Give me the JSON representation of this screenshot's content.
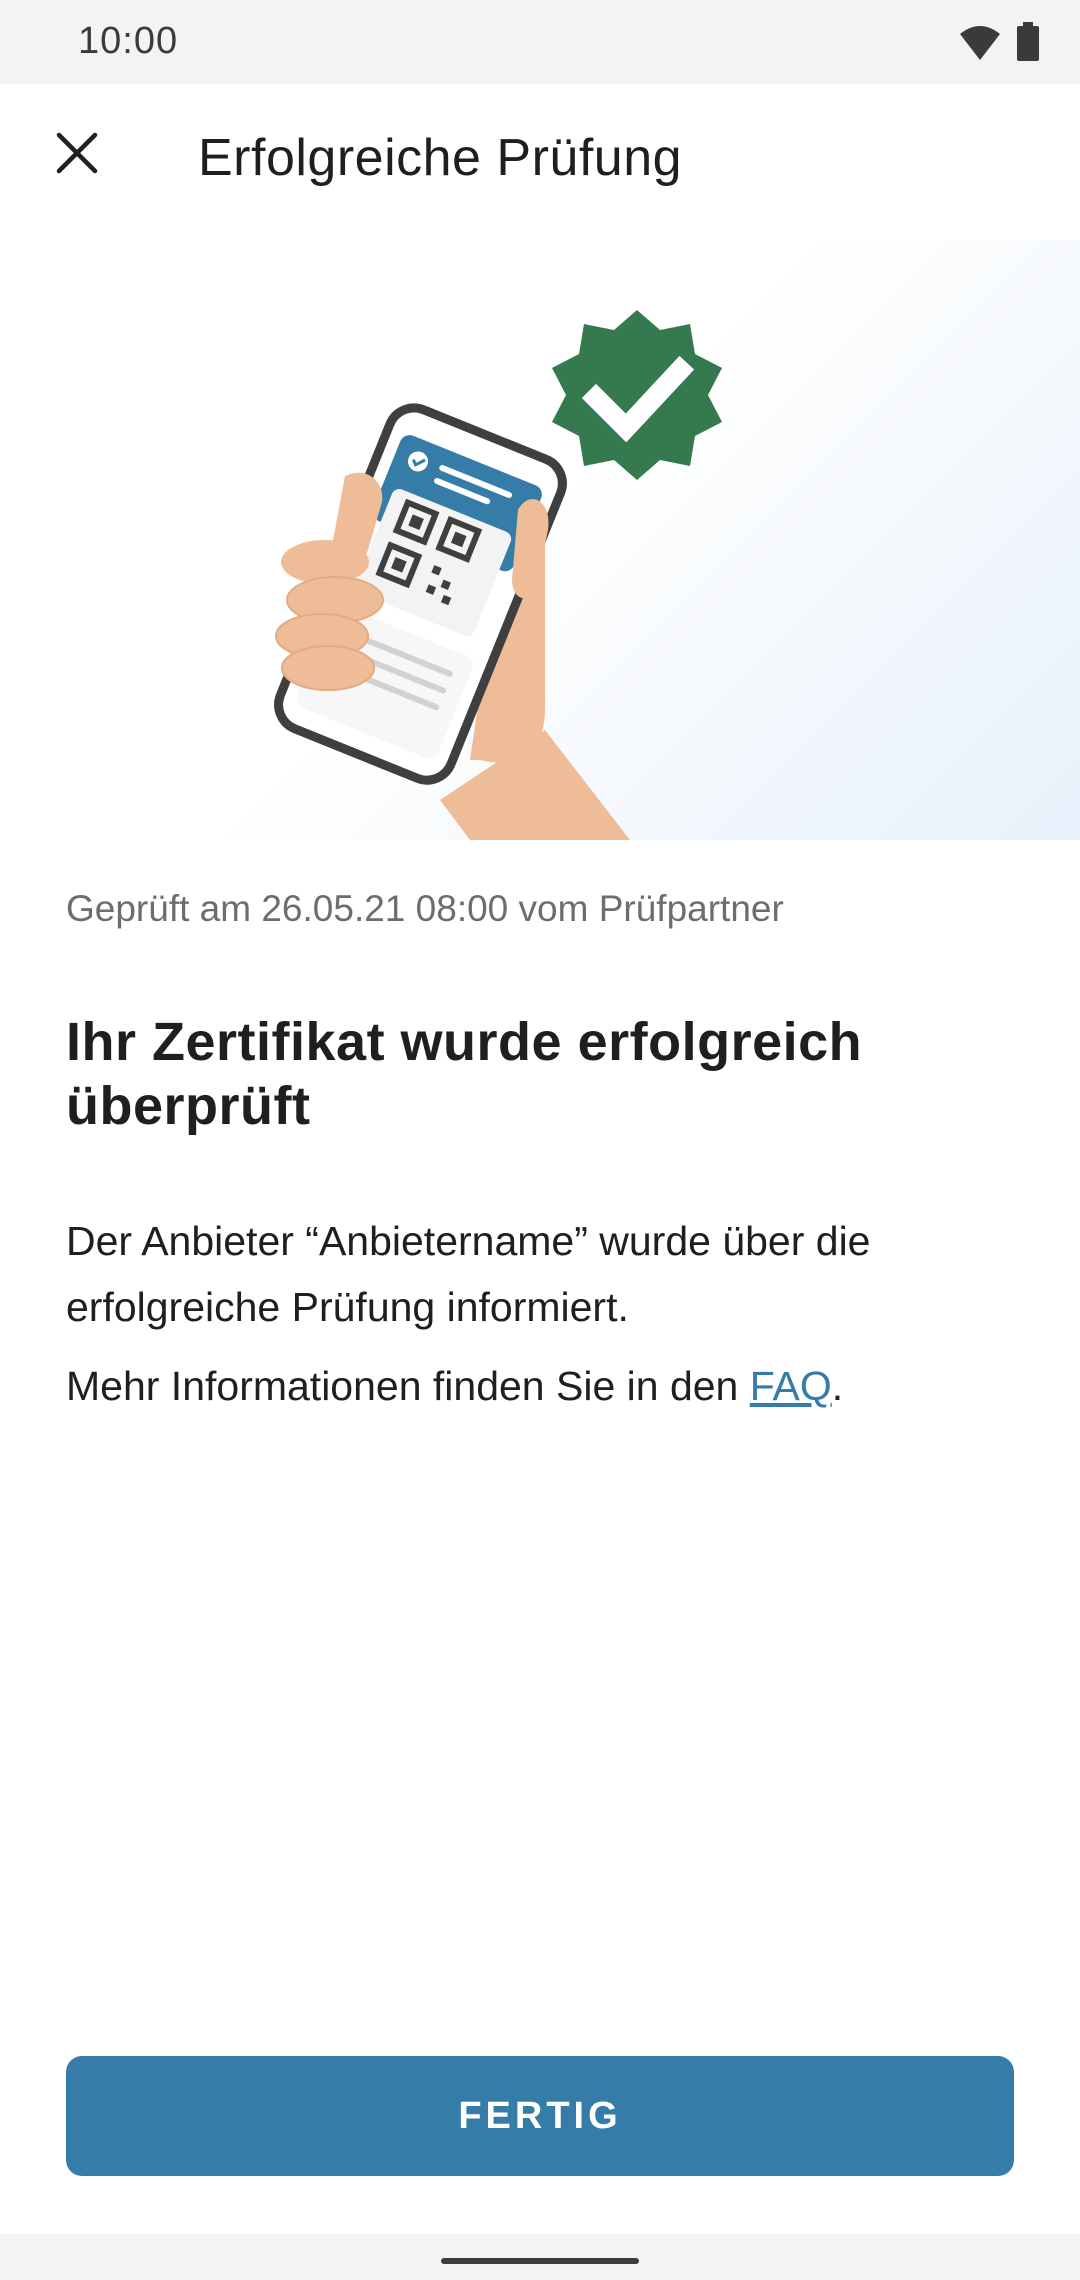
{
  "status_bar": {
    "time": "10:00",
    "icons": [
      "wifi-icon",
      "battery-icon"
    ]
  },
  "header": {
    "close_icon": "close-icon",
    "title": "Erfolgreiche Prüfung"
  },
  "illustration": {
    "description_icons": [
      "phone-in-hand",
      "check-badge-icon",
      "qr-code-icon"
    ],
    "badge_color": "#357a4f"
  },
  "content": {
    "meta": "Geprüft am 26.05.21 08:00 vom Prüfpartner",
    "headline": "Ihr Zertifikat wurde erfolgreich überprüft",
    "body_paragraph": "Der Anbieter “Anbietername” wurde über die erfolgreiche Prüfung informiert.",
    "faq_prefix": "Mehr Informationen finden Sie in den ",
    "faq_link": "FAQ",
    "faq_suffix": "."
  },
  "footer": {
    "done_button": "FERTIG"
  },
  "colors": {
    "accent": "#357ca9",
    "success": "#357a4f",
    "status_bar_bg": "#f3f3f3"
  }
}
